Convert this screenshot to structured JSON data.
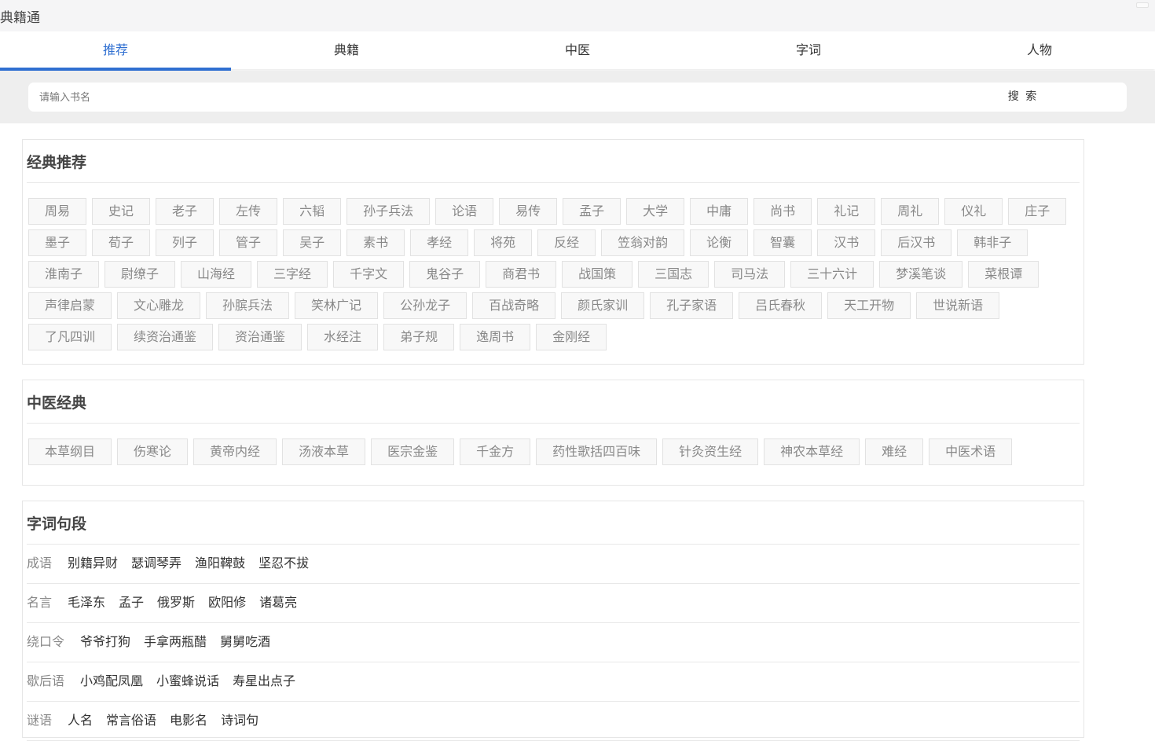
{
  "app": {
    "title": "典籍通"
  },
  "tabs": [
    {
      "label": "推荐",
      "active": true
    },
    {
      "label": "典籍",
      "active": false
    },
    {
      "label": "中医",
      "active": false
    },
    {
      "label": "字词",
      "active": false
    },
    {
      "label": "人物",
      "active": false
    }
  ],
  "search": {
    "placeholder": "请输入书名",
    "value": "",
    "button_label": "搜 索"
  },
  "classics": {
    "title": "经典推荐",
    "items": [
      "周易",
      "史记",
      "老子",
      "左传",
      "六韬",
      "孙子兵法",
      "论语",
      "易传",
      "孟子",
      "大学",
      "中庸",
      "尚书",
      "礼记",
      "周礼",
      "仪礼",
      "庄子",
      "墨子",
      "荀子",
      "列子",
      "管子",
      "吴子",
      "素书",
      "孝经",
      "将苑",
      "反经",
      "笠翁对韵",
      "论衡",
      "智囊",
      "汉书",
      "后汉书",
      "韩非子",
      "淮南子",
      "尉缭子",
      "山海经",
      "三字经",
      "千字文",
      "鬼谷子",
      "商君书",
      "战国策",
      "三国志",
      "司马法",
      "三十六计",
      "梦溪笔谈",
      "菜根谭",
      "声律启蒙",
      "文心雕龙",
      "孙膑兵法",
      "笑林广记",
      "公孙龙子",
      "百战奇略",
      "颜氏家训",
      "孔子家语",
      "吕氏春秋",
      "天工开物",
      "世说新语",
      "了凡四训",
      "续资治通鉴",
      "资治通鉴",
      "水经注",
      "弟子规",
      "逸周书",
      "金刚经"
    ]
  },
  "tcm": {
    "title": "中医经典",
    "items": [
      "本草纲目",
      "伤寒论",
      "黄帝内经",
      "汤液本草",
      "医宗金鉴",
      "千金方",
      "药性歌括四百味",
      "针灸资生经",
      "神农本草经",
      "难经",
      "中医术语"
    ]
  },
  "words": {
    "title": "字词句段",
    "rows": [
      {
        "label": "成语",
        "items": [
          "别籍异财",
          "瑟调琴弄",
          "渔阳鞞鼓",
          "坚忍不拔"
        ]
      },
      {
        "label": "名言",
        "items": [
          "毛泽东",
          "孟子",
          "俄罗斯",
          "欧阳修",
          "诸葛亮"
        ]
      },
      {
        "label": "绕口令",
        "items": [
          "爷爷打狗",
          "手拿两瓶醋",
          "舅舅吃酒"
        ]
      },
      {
        "label": "歇后语",
        "items": [
          "小鸡配凤凰",
          "小蜜蜂说话",
          "寿星出点子"
        ]
      },
      {
        "label": "谜语",
        "items": [
          "人名",
          "常言俗语",
          "电影名",
          "诗词句"
        ]
      }
    ]
  }
}
